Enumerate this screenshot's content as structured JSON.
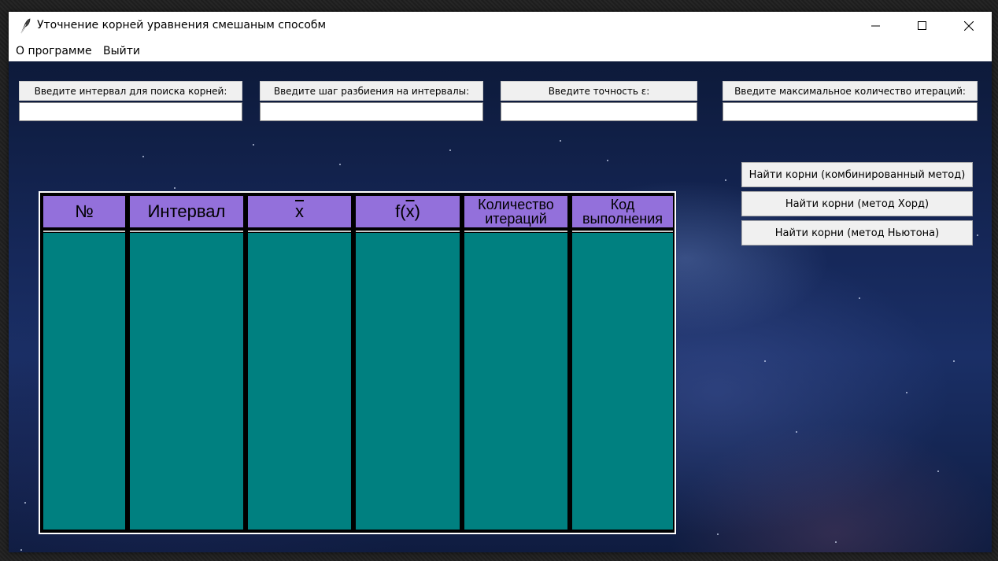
{
  "window": {
    "title": "Уточнение корней уравнения смешаным способм",
    "controls": {
      "minimize_icon": "minimize-icon",
      "maximize_icon": "maximize-icon",
      "close_icon": "close-icon"
    }
  },
  "menu": {
    "items": [
      {
        "label": "О программе"
      },
      {
        "label": "Выйти"
      }
    ]
  },
  "inputs": [
    {
      "label": "Введите интервал для поиска корней:",
      "value": ""
    },
    {
      "label": "Введите шаг разбиения на интервалы:",
      "value": ""
    },
    {
      "label": "Введите точность ε:",
      "value": ""
    },
    {
      "label": "Введите максимальное количество итераций:",
      "value": ""
    }
  ],
  "actions": [
    {
      "label": "Найти корни (комбинированный метод)"
    },
    {
      "label": "Найти корни (метод Хорд)"
    },
    {
      "label": "Найти корни (метод Ньютона)"
    }
  ],
  "table": {
    "columns": [
      {
        "label": "№"
      },
      {
        "label": "Интервал"
      },
      {
        "label": "x"
      },
      {
        "label_prefix": "f(",
        "label_var": "x",
        "label_suffix": ")"
      },
      {
        "label_line1": "Количество",
        "label_line2": "итераций"
      },
      {
        "label_line1": "Код",
        "label_line2": "выполнения"
      }
    ],
    "colors": {
      "header": "#9370db",
      "body": "#008080",
      "frame": "#000000"
    }
  }
}
